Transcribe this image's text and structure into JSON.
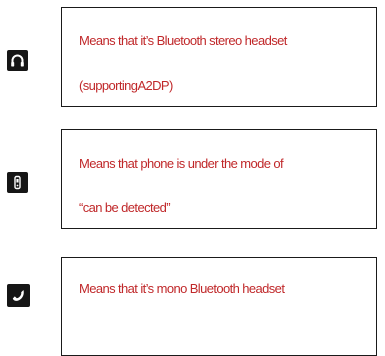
{
  "legend": {
    "items": [
      {
        "icon": "headphones-icon",
        "lines": [
          "Means that it’s Bluetooth stereo headset",
          "(supportingA2DP)"
        ]
      },
      {
        "icon": "phone-discoverable-icon",
        "lines": [
          "Means that phone is under the mode of",
          "“can be detected”"
        ]
      },
      {
        "icon": "phone-handset-icon",
        "lines": [
          "Means that it’s mono Bluetooth headset"
        ]
      }
    ]
  },
  "colors": {
    "text": "#c0282a",
    "icon_background": "#161616",
    "border": "#1a1a1a"
  }
}
